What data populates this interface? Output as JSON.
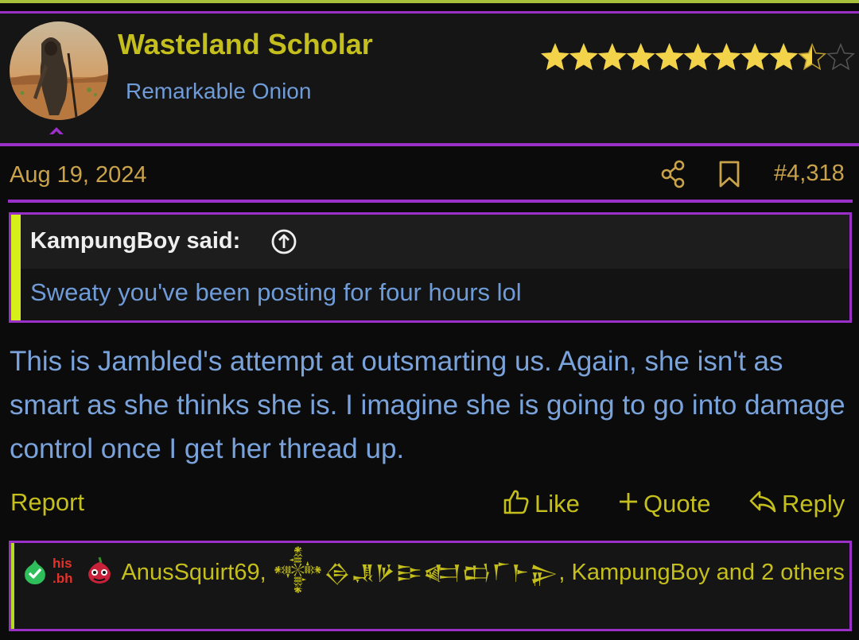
{
  "user": {
    "name": "Wasteland Scholar",
    "title": "Remarkable Onion",
    "rating_filled": 9.5,
    "rating_max": 11
  },
  "post": {
    "date": "Aug 19, 2024",
    "number": "#4,318",
    "quote": {
      "author": "KampungBoy said:",
      "text": "Sweaty you've been posting for four hours lol"
    },
    "body": "This is Jambled's attempt at outsmarting us. Again, she isn't as smart as she thinks she is. I imagine she is going to go into damage control once I get her thread up."
  },
  "actions": {
    "report": "Report",
    "like": "Like",
    "quote": "Quote",
    "reply": "Reply"
  },
  "reactions": {
    "names_prefix": "AnusSquirt69,",
    "cuneiform_name": "𒀱𒁲𒂗𒃻𒄿𒅗𒆗𒇲𒈨𒉌",
    "names_suffix": ", KampungBoy and 2 others",
    "badge_icons": [
      "check-onion-icon",
      "his-bh-icon",
      "red-onion-icon"
    ]
  },
  "colors": {
    "accent_purple": "#9b30c8",
    "name_yellow": "#c4bf1c",
    "text_blue": "#7aa3db",
    "date_gold": "#c9a24a"
  }
}
